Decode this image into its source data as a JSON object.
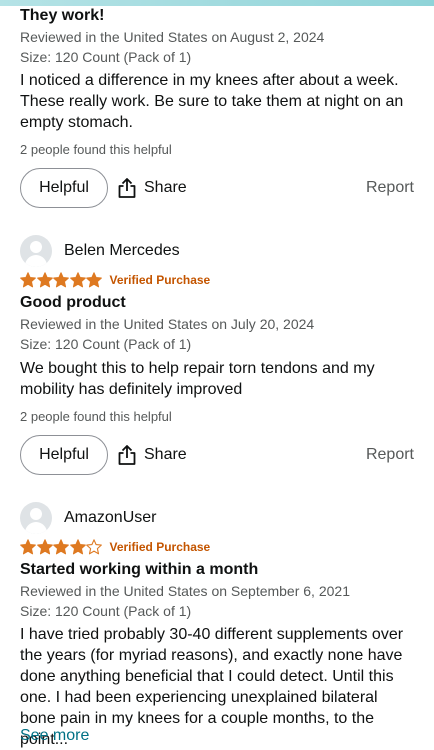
{
  "reviews": [
    {
      "title": "They work!",
      "meta": "Reviewed in the United States on August 2, 2024",
      "size": "Size: 120 Count (Pack of 1)",
      "text": "I noticed a difference in my knees after about a week. These really work. Be sure to take them at night on an empty stomach.",
      "helpful_count": "2 people found this helpful",
      "helpful_label": "Helpful",
      "share_label": "Share",
      "report_label": "Report"
    },
    {
      "user": "Belen Mercedes",
      "rating": 5,
      "verified": "Verified Purchase",
      "title": "Good product",
      "meta": "Reviewed in the United States on July 20, 2024",
      "size": "Size: 120 Count (Pack of 1)",
      "text": "We bought this to help repair torn tendons and my mobility has definitely improved",
      "helpful_count": "2 people found this helpful",
      "helpful_label": "Helpful",
      "share_label": "Share",
      "report_label": "Report"
    },
    {
      "user": "AmazonUser",
      "rating": 4,
      "verified": "Verified Purchase",
      "title": "Started working within a month",
      "meta": "Reviewed in the United States on September 6, 2021",
      "size": "Size: 120 Count (Pack of 1)",
      "text": "I have tried probably 30-40 different supplements over the years (for myriad reasons), and exactly none have done anything beneficial that I could detect. Until this one. I had been experiencing unexplained bilateral bone pain in my knees for a couple months, to the point...",
      "see_more": "See more"
    }
  ],
  "colors": {
    "star": "#de7921",
    "verified": "#c45500",
    "link": "#007185"
  },
  "icons": {
    "avatar": "user-avatar-icon",
    "star": "star-icon",
    "share": "share-icon"
  }
}
